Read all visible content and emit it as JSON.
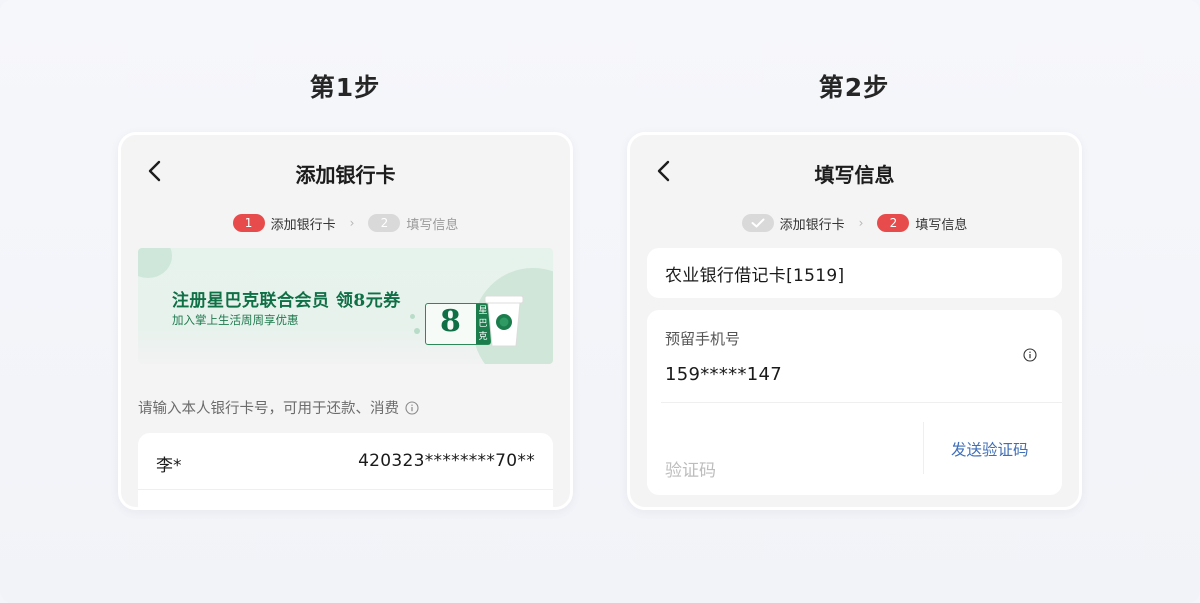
{
  "steps": [
    {
      "heading": "第1步",
      "nav_title": "添加银行卡",
      "stepper": {
        "s1_badge": "1",
        "s1_label": "添加银行卡",
        "s2_badge": "2",
        "s2_label": "填写信息"
      },
      "banner": {
        "title": "注册星巴克联合会员 领8元券",
        "subtitle": "加入掌上生活周周享优惠",
        "coupon_value": "8",
        "coupon_side": "星巴克"
      },
      "hint": "请输入本人银行卡号，可用于还款、消费",
      "card_row": {
        "name": "李*",
        "number": "420323********70**"
      }
    },
    {
      "heading": "第2步",
      "nav_title": "填写信息",
      "stepper": {
        "s1_label": "添加银行卡",
        "s2_badge": "2",
        "s2_label": "填写信息"
      },
      "bank_card": "农业银行借记卡[1519]",
      "phone_label": "预留手机号",
      "phone_value": "159*****147",
      "code_placeholder": "验证码",
      "send_code": "发送验证码"
    }
  ],
  "colors": {
    "accent_red": "#e84b4b",
    "link_blue": "#3f6fb8",
    "brand_green": "#0f6f45"
  },
  "icons": [
    "back-icon",
    "chevron-right-icon",
    "info-icon",
    "check-icon",
    "coffee-cup-icon"
  ]
}
